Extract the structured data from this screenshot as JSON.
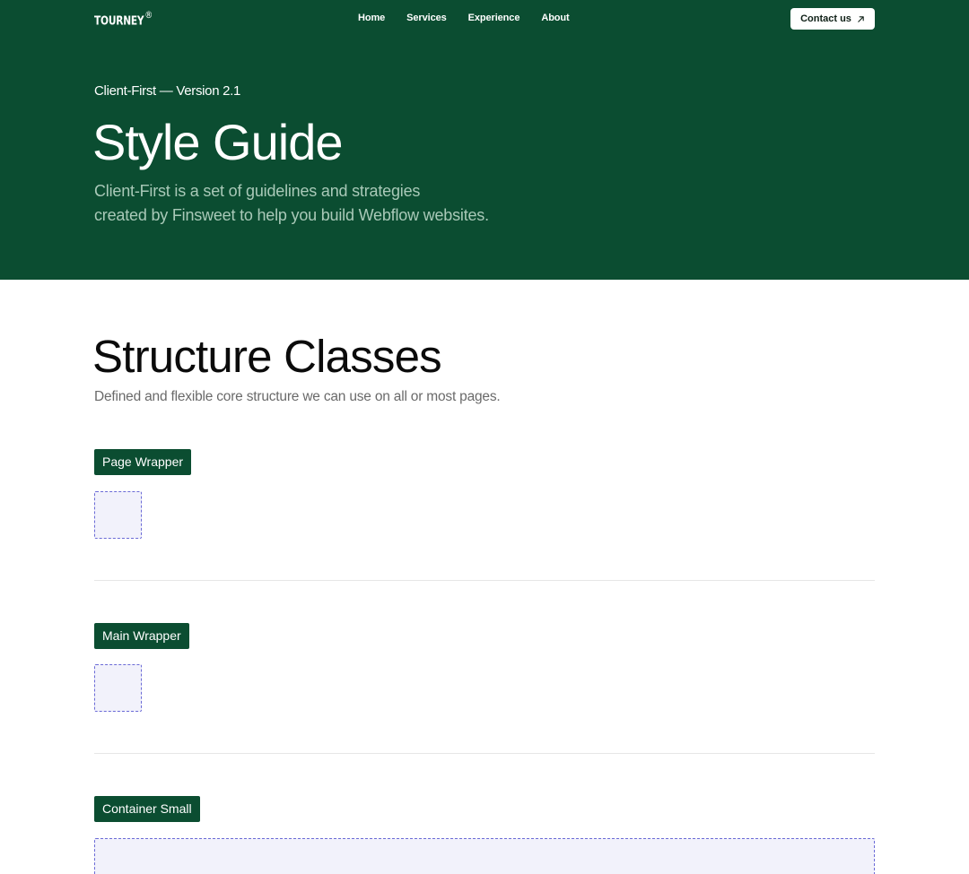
{
  "nav": {
    "logo": "TOURNEY",
    "logo_mark": "®",
    "links": [
      "Home",
      "Services",
      "Experience",
      "About"
    ],
    "contact_label": "Contact us"
  },
  "hero": {
    "eyebrow": "Client-First — Version 2.1",
    "title": "Style Guide",
    "description_line1": "Client-First is a set of guidelines and strategies",
    "description_line2": "created by Finsweet to help you build Webflow websites."
  },
  "structure": {
    "title": "Structure Classes",
    "description": "Defined and flexible core structure we can use on all or most pages.",
    "items": [
      {
        "label": "Page Wrapper"
      },
      {
        "label": "Main Wrapper"
      },
      {
        "label": "Container Small"
      }
    ]
  },
  "colors": {
    "brand_green": "#0b4d31",
    "hero_muted_text": "#a9c9b8",
    "demo_fill": "#f2f2fb",
    "demo_border": "#6a6ad6"
  }
}
